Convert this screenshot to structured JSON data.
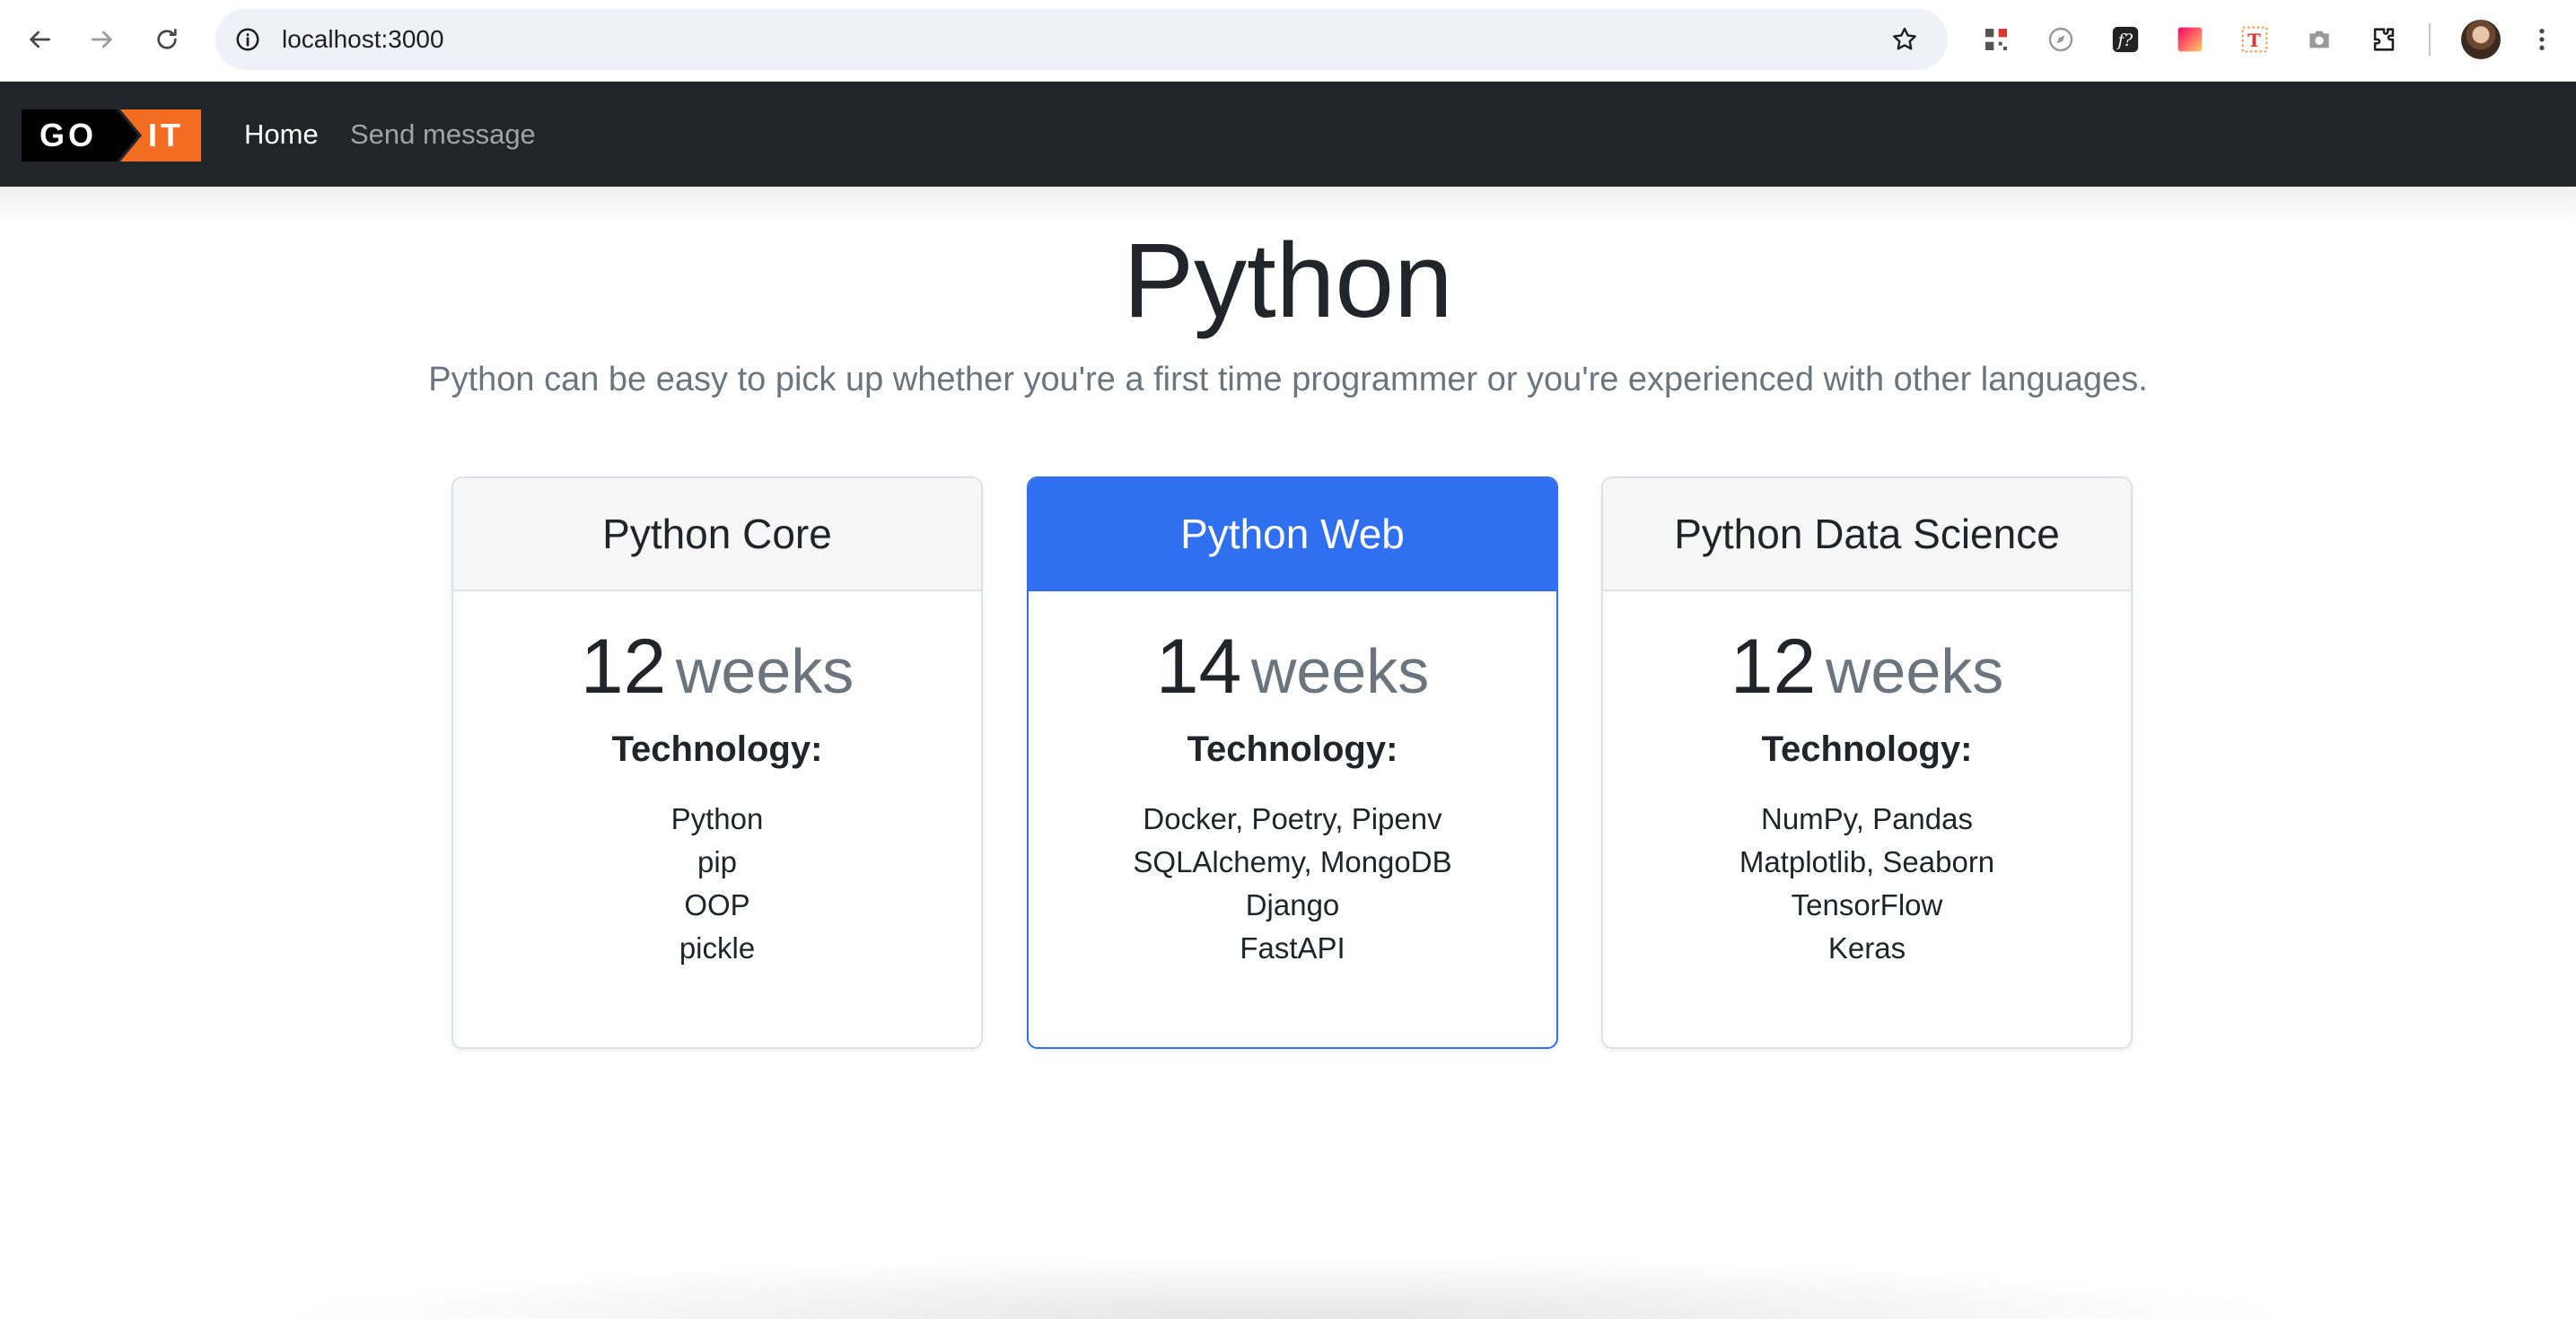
{
  "browser": {
    "url": "localhost:3000"
  },
  "navbar": {
    "logo_left": "GO",
    "logo_right": "IT",
    "links": [
      {
        "label": "Home",
        "active": true
      },
      {
        "label": "Send message",
        "active": false
      }
    ]
  },
  "hero": {
    "title": "Python",
    "lead": "Python can be easy to pick up whether you're a first time programmer or you're experienced with other languages."
  },
  "cards": [
    {
      "title": "Python Core",
      "duration_value": "12",
      "duration_unit": "weeks",
      "tech_heading": "Technology:",
      "technologies": [
        "Python",
        "pip",
        "OOP",
        "pickle"
      ],
      "highlighted": false
    },
    {
      "title": "Python Web",
      "duration_value": "14",
      "duration_unit": "weeks",
      "tech_heading": "Technology:",
      "technologies": [
        "Docker, Poetry, Pipenv",
        "SQLAlchemy, MongoDB",
        "Django",
        "FastAPI"
      ],
      "highlighted": true
    },
    {
      "title": "Python Data Science",
      "duration_value": "12",
      "duration_unit": "weeks",
      "tech_heading": "Technology:",
      "technologies": [
        "NumPy, Pandas",
        "Matplotlib, Seaborn",
        "TensorFlow",
        "Keras"
      ],
      "highlighted": false
    }
  ],
  "colors": {
    "navbar_bg": "#212529",
    "primary": "#2f6ff0",
    "logo_accent": "#f26c22"
  }
}
